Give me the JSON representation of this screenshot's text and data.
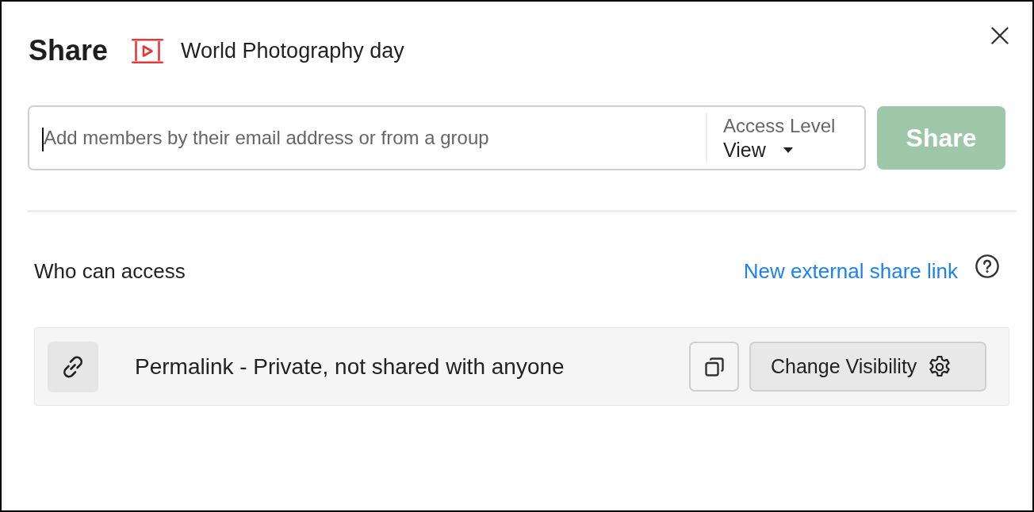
{
  "dialog": {
    "title": "Share",
    "item_name": "World Photography day"
  },
  "invite": {
    "placeholder": "Add members by their email address or from a group",
    "focused": true,
    "access_label": "Access Level",
    "access_value": "View",
    "share_button": {
      "label": "Share",
      "disabled": true
    }
  },
  "access": {
    "heading": "Who can access",
    "new_link": "New external share link",
    "entries": [
      {
        "text": "Permalink - Private, not shared with anyone",
        "visibility_button": "Change Visibility"
      }
    ]
  }
}
